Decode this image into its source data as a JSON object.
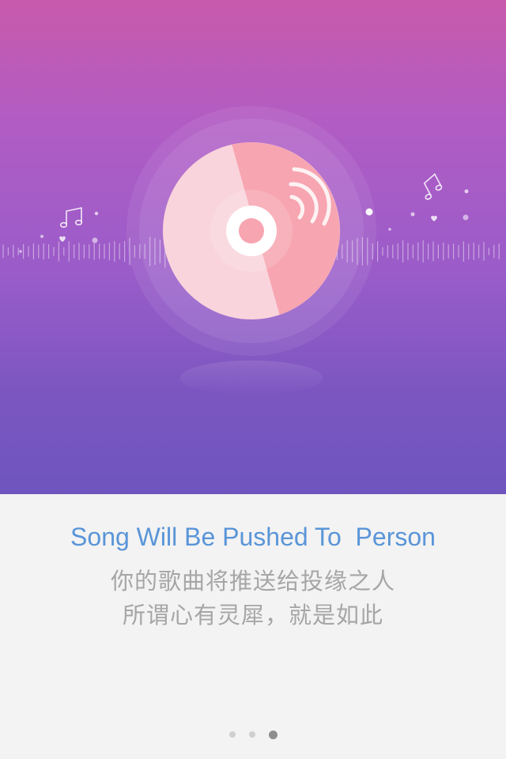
{
  "onboarding": {
    "headline": "Song Will Be Pushed To  Person",
    "subtitle_line1": "你的歌曲将推送给投缘之人",
    "subtitle_line2": "所谓心有灵犀，就是如此"
  },
  "pager": {
    "page_count": 3,
    "current_page": 3
  },
  "illustration": {
    "icons": [
      "vinyl-disc-icon",
      "sound-waves-icon",
      "music-note-icon",
      "heart-icon"
    ]
  },
  "colors": {
    "hero_top": "#c85aab",
    "hero_bottom": "#6f55bf",
    "headline": "#5a95d8",
    "subtitle": "#a6a6a6",
    "disc_light": "#fad4dc",
    "disc_dark": "#f7a5b1",
    "dot_active": "#8e8e8e",
    "dot_inactive": "#cfcfcf"
  }
}
